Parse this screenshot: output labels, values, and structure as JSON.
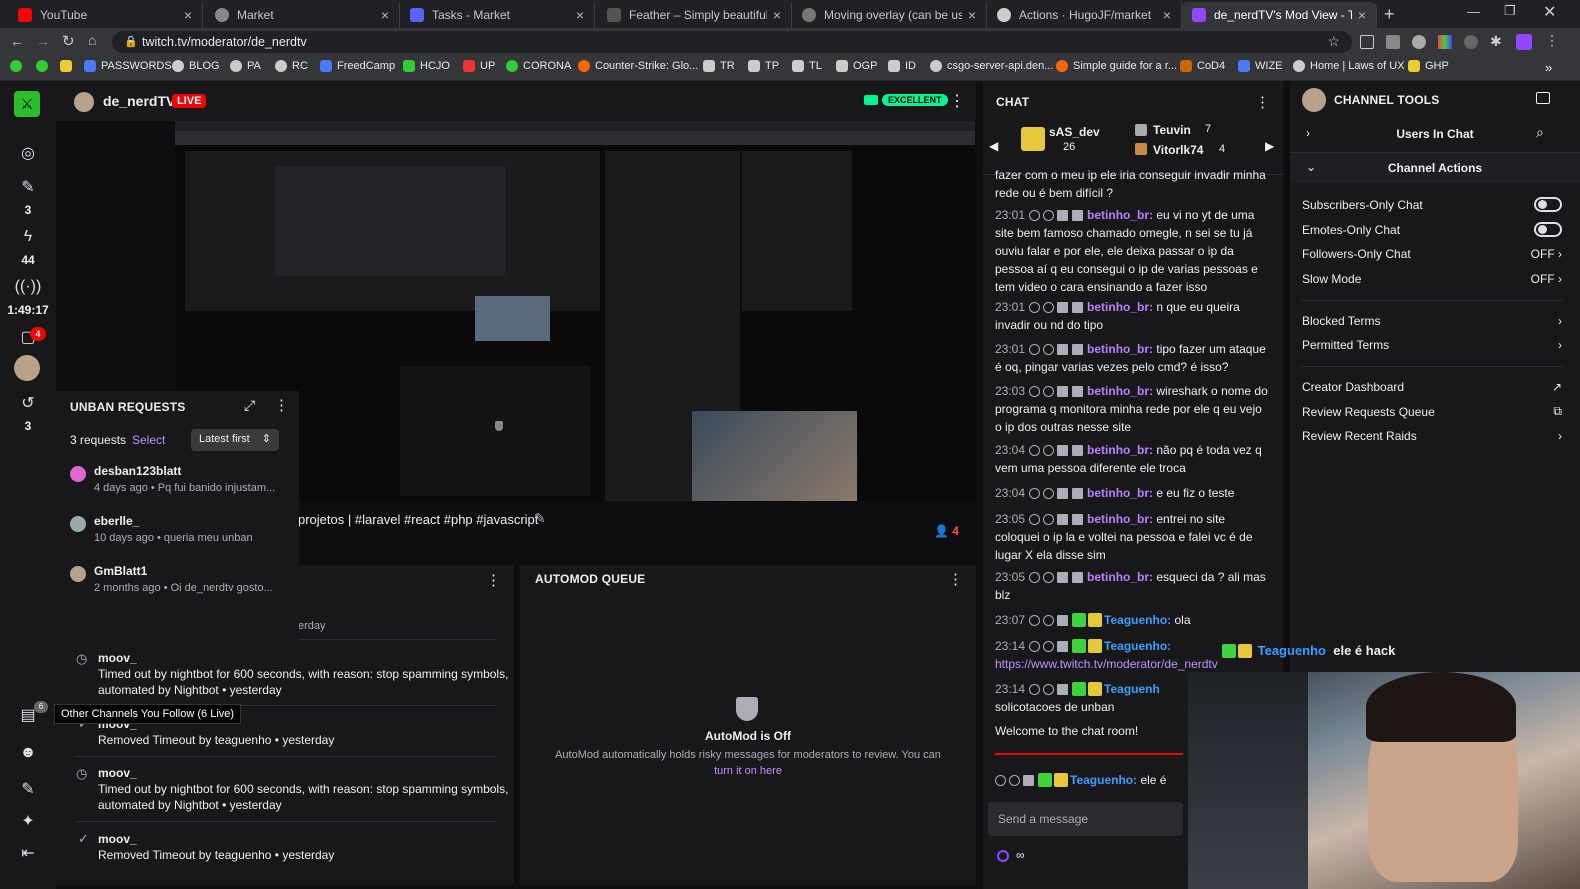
{
  "browser": {
    "tabs": [
      {
        "title": "YouTube",
        "color": "#ff0000"
      },
      {
        "title": "Market",
        "color": "#888888"
      },
      {
        "title": "Tasks - Market",
        "color": "#5865f2"
      },
      {
        "title": "Feather – Simply beautiful open",
        "color": "#555555"
      },
      {
        "title": "Moving overlay (can be used for",
        "color": "#777777"
      },
      {
        "title": "Actions · HugoJF/market",
        "color": "#cccccc"
      },
      {
        "title": "de_nerdTV's Mod View - Twitch",
        "color": "#9147ff"
      }
    ],
    "url": "twitch.tv/moderator/de_nerdtv",
    "bookmarks": [
      "PASSWORDS",
      "BLOG",
      "PA",
      "RC",
      "FreedCamp",
      "HCJO",
      "UP",
      "CORONA",
      "Counter-Strike: Glo...",
      "TR",
      "TP",
      "TL",
      "OGP",
      "ID",
      "csgo-server-api.den...",
      "Simple guide for a r...",
      "CoD4",
      "WIZE",
      "Home | Laws of UX",
      "GHP"
    ]
  },
  "rail": {
    "count1": "3",
    "count2": "44",
    "uptime": "1:49:17",
    "count3": "3",
    "notif_badge": "4",
    "follow_badge": "6",
    "tooltip": "Other Channels You Follow (6 Live)"
  },
  "stream": {
    "channel": "de_nerdTV",
    "live": "LIVE",
    "quality": "EXCELLENT",
    "title": "projetos | #laravel #react #php #javascript",
    "viewers": "4"
  },
  "unban": {
    "title": "UNBAN REQUESTS",
    "count": "3 requests",
    "select": "Select",
    "sort": "Latest first",
    "items": [
      {
        "user": "desban123blatt",
        "meta": "4 days ago • Pq fui banido injustam..."
      },
      {
        "user": "eberlle_",
        "meta": "10 days ago • queria meu unban"
      },
      {
        "user": "GmBlatt1",
        "meta": "2 months ago • Oi de_nerdtv gosto..."
      }
    ]
  },
  "activity": {
    "partial": "erday",
    "items": [
      {
        "user": "moov_",
        "text": "Timed out by nightbot for 600 seconds, with reason: stop spamming symbols, automated by Nightbot • yesterday"
      },
      {
        "user": "moov_",
        "text": "Removed Timeout by teaguenho • yesterday"
      },
      {
        "user": "moov_",
        "text": "Timed out by nightbot for 600 seconds, with reason: stop spamming symbols, automated by Nightbot • yesterday"
      },
      {
        "user": "moov_",
        "text": "Removed Timeout by teaguenho • yesterday"
      }
    ]
  },
  "automod": {
    "title": "AUTOMOD QUEUE",
    "status": "AutoMod is Off",
    "desc": "AutoMod automatically holds risky messages for moderators to review. You can",
    "link": "turn it on here"
  },
  "chat": {
    "title": "CHAT",
    "top1": {
      "name": "sAS_dev",
      "count": "26"
    },
    "top2": {
      "name": "Teuvin",
      "count": "7"
    },
    "top3": {
      "name": "Vitorlk74",
      "count": "4"
    },
    "partial": "fazer com o meu ip ele iria conseguir invadir minha rede ou é bem difícil ?",
    "messages": [
      {
        "ts": "23:01",
        "user": "betinho_br:",
        "text": "eu vi no yt de uma site bem famoso chamado omegle, n sei se tu já ouviu falar e por ele, ele deixa passar o ip da pessoa aí q eu consegui o ip de varias pessoas e tem video o cara ensinando a fazer isso"
      },
      {
        "ts": "23:01",
        "user": "betinho_br:",
        "text": "n que eu queira invadir ou nd do tipo"
      },
      {
        "ts": "23:01",
        "user": "betinho_br:",
        "text": "tipo fazer um ataque é oq, pingar varias vezes pelo cmd? é isso?"
      },
      {
        "ts": "23:03",
        "user": "betinho_br:",
        "text": "wireshark o nome do programa q monitora minha rede por ele q eu vejo o ip dos outras nesse site"
      },
      {
        "ts": "23:04",
        "user": "betinho_br:",
        "text": "não pq é toda vez q vem uma pessoa diferente ele troca"
      },
      {
        "ts": "23:04",
        "user": "betinho_br:",
        "text": "e eu fiz o teste"
      },
      {
        "ts": "23:05",
        "user": "betinho_br:",
        "text": "entrei no site coloquei o ip la e voltei na pessoa e falei vc é de lugar X ela disse sim"
      },
      {
        "ts": "23:05",
        "user": "betinho_br:",
        "text": "esqueci da ? ali mas blz"
      },
      {
        "ts": "23:07",
        "user": "Teaguenho:",
        "text": "ola"
      }
    ],
    "msg_link_ts": "23:14",
    "msg_link_user": "Teaguenho:",
    "msg_link": "https://www.twitch.tv/moderator/de_nerdtv",
    "msg_last_ts": "23:14",
    "msg_last_user": "Teaguenh",
    "msg_last_text": "solicotacoes de unban",
    "welcome": "Welcome to the chat room!",
    "pinned_user": "Teaguenho:",
    "pinned_text": "ele é",
    "overlay_user": "Teaguenho",
    "overlay_text": "ele é hack",
    "placeholder": "Send a message",
    "infinity": "∞"
  },
  "tools": {
    "title": "CHANNEL TOOLS",
    "users_in_chat": "Users In Chat",
    "channel_actions": "Channel Actions",
    "rows": [
      {
        "label": "Subscribers-Only Chat",
        "value": ""
      },
      {
        "label": "Emotes-Only Chat",
        "value": ""
      },
      {
        "label": "Followers-Only Chat",
        "value": "OFF"
      },
      {
        "label": "Slow Mode",
        "value": "OFF"
      },
      {
        "label": "Blocked Terms",
        "value": ""
      },
      {
        "label": "Permitted Terms",
        "value": ""
      },
      {
        "label": "Creator Dashboard",
        "value": ""
      },
      {
        "label": "Review Requests Queue",
        "value": ""
      },
      {
        "label": "Review Recent Raids",
        "value": ""
      }
    ]
  }
}
